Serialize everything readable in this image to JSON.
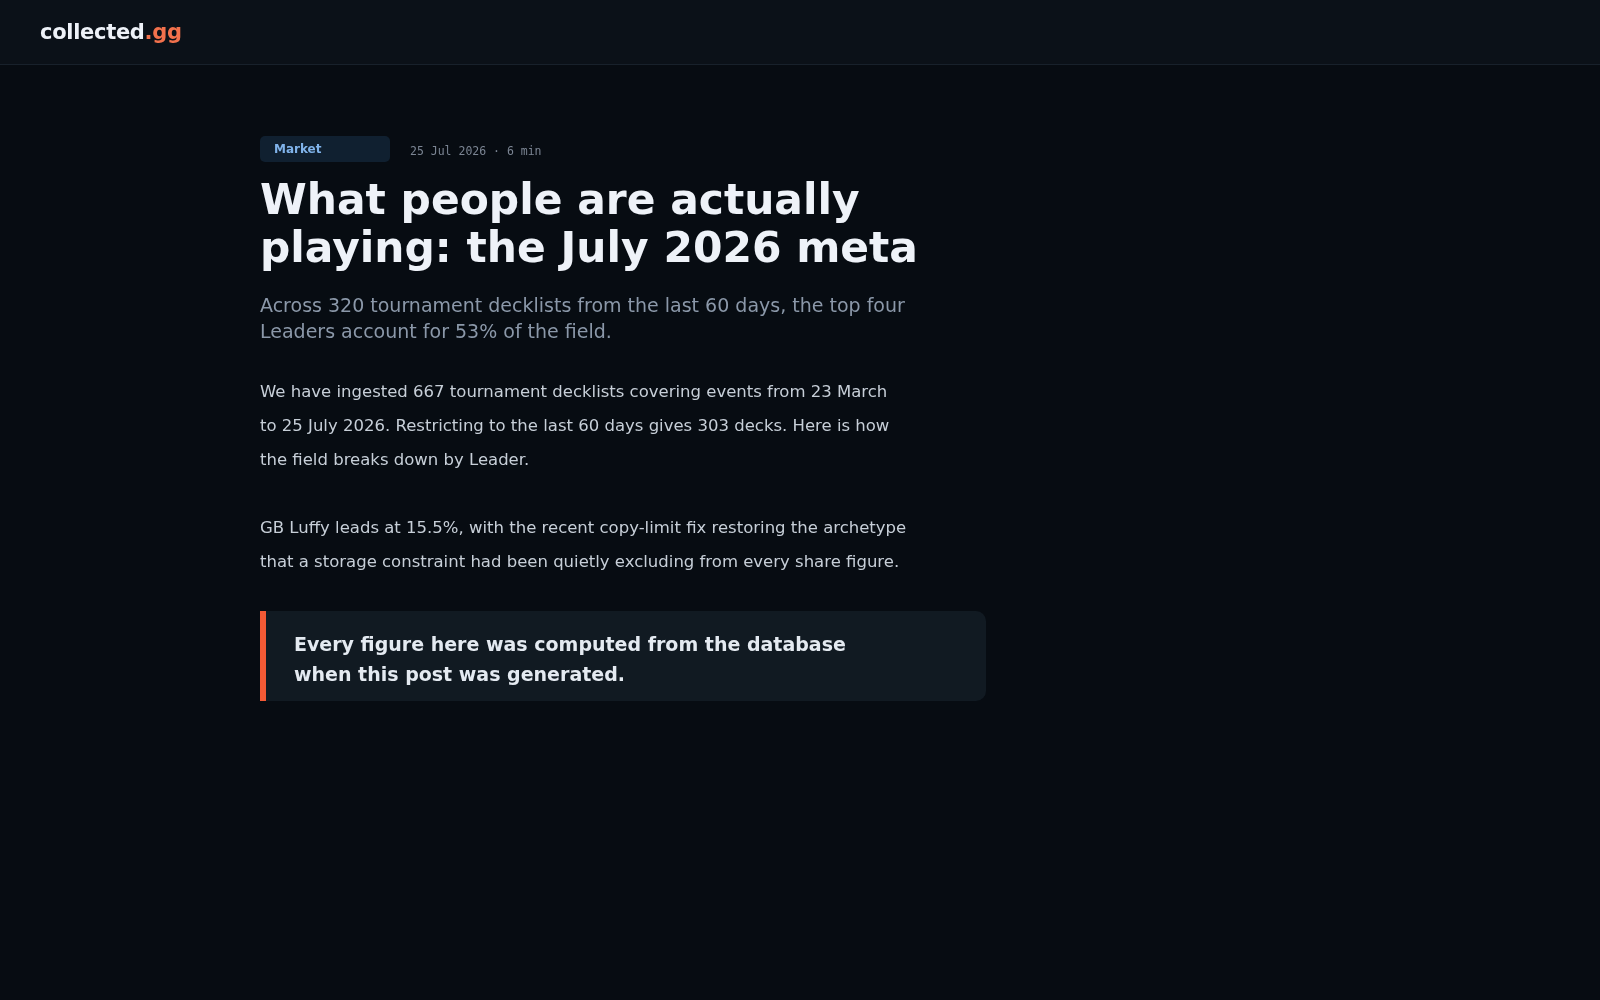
{
  "header": {
    "logo": {
      "text": "collected",
      "accent": ".gg"
    }
  },
  "article": {
    "tag": "Market",
    "meta": "25 Jul 2026 · 6 min",
    "title": "What people are actually playing: the July 2026 meta",
    "subtitle": "Across 320 tournament decklists from the last 60 days, the top four Leaders account for 53% of the field.",
    "paragraphs": [
      "We have ingested 667 tournament decklists covering events from 23 March to 25 July 2026. Restricting to the last 60 days gives 303 decks. Here is how the field breaks down by Leader.",
      "GB Luffy leads at 15.5%, with the recent copy-limit fix restoring the archetype that a storage constraint had been quietly excluding from every share figure."
    ],
    "callout": "Every figure here was computed from the database when this post was generated."
  }
}
